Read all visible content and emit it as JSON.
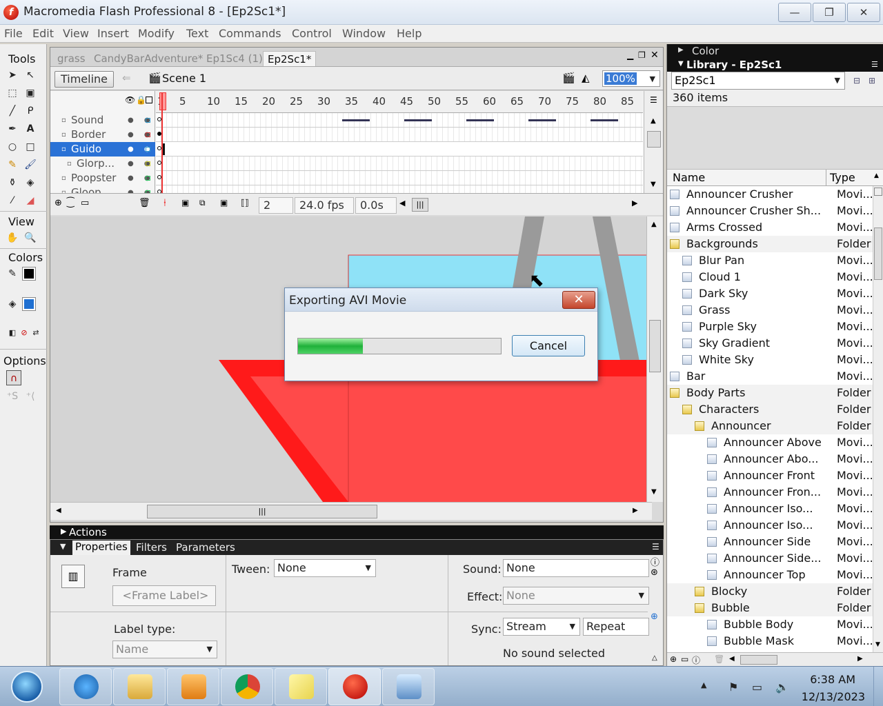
{
  "window": {
    "title": "Macromedia Flash Professional 8 - [Ep2Sc1*]",
    "app_icon_glyph": "f",
    "minimize_glyph": "—",
    "restore_glyph": "❐",
    "close_glyph": "✕"
  },
  "menu": [
    "File",
    "Edit",
    "View",
    "Insert",
    "Modify",
    "Text",
    "Commands",
    "Control",
    "Window",
    "Help"
  ],
  "tools": {
    "tools_label": "Tools",
    "view_label": "View",
    "colors_label": "Colors",
    "options_label": "Options"
  },
  "document": {
    "tabs": [
      "grass",
      "CandyBarAdventure*",
      "Ep1Sc4 (1)",
      "Ep2Sc1*"
    ],
    "active_tab": 3,
    "timeline_button": "Timeline",
    "scene_label": "Scene 1",
    "zoom": "100%"
  },
  "timeline": {
    "layers": [
      {
        "name": "Sound",
        "selected": false
      },
      {
        "name": "Border",
        "selected": false
      },
      {
        "name": "Guido",
        "selected": true
      },
      {
        "name": "Glorp...",
        "selected": false
      },
      {
        "name": "Poopster",
        "selected": false
      },
      {
        "name": "Gloop",
        "selected": false
      }
    ],
    "ruler": [
      "1",
      "5",
      "10",
      "15",
      "20",
      "25",
      "30",
      "35",
      "40",
      "45",
      "50",
      "55",
      "60",
      "65",
      "70",
      "75",
      "80",
      "85"
    ],
    "current_frame": "2",
    "fps": "24.0 fps",
    "elapsed": "0.0s"
  },
  "properties": {
    "actions_label": "Actions",
    "tabs": [
      "Properties",
      "Filters",
      "Parameters"
    ],
    "frame_label": "Frame",
    "frame_label_placeholder": "<Frame Label>",
    "label_type_label": "Label type:",
    "label_type_value": "Name",
    "tween_label": "Tween:",
    "tween_value": "None",
    "sound_label": "Sound:",
    "sound_value": "None",
    "effect_label": "Effect:",
    "effect_value": "None",
    "sync_label": "Sync:",
    "sync_value": "Stream",
    "repeat_value": "Repeat",
    "no_sound": "No sound selected"
  },
  "library": {
    "color_panel_label": "Color",
    "library_label": "Library - Ep2Sc1",
    "document_select": "Ep2Sc1",
    "item_count": "360 items",
    "col_name": "Name",
    "col_type": "Type",
    "items": [
      {
        "name": "Announcer Crusher",
        "type": "Movi...",
        "level": 0,
        "folder": false
      },
      {
        "name": "Announcer Crusher Sh...",
        "type": "Movi...",
        "level": 0,
        "folder": false
      },
      {
        "name": "Arms Crossed",
        "type": "Movi...",
        "level": 0,
        "folder": false
      },
      {
        "name": "Backgrounds",
        "type": "Folder",
        "level": 0,
        "folder": true
      },
      {
        "name": "Blur Pan",
        "type": "Movi...",
        "level": 1,
        "folder": false
      },
      {
        "name": "Cloud 1",
        "type": "Movi...",
        "level": 1,
        "folder": false
      },
      {
        "name": "Dark Sky",
        "type": "Movi...",
        "level": 1,
        "folder": false
      },
      {
        "name": "Grass",
        "type": "Movi...",
        "level": 1,
        "folder": false
      },
      {
        "name": "Purple Sky",
        "type": "Movi...",
        "level": 1,
        "folder": false
      },
      {
        "name": "Sky Gradient",
        "type": "Movi...",
        "level": 1,
        "folder": false
      },
      {
        "name": "White Sky",
        "type": "Movi...",
        "level": 1,
        "folder": false
      },
      {
        "name": "Bar",
        "type": "Movi...",
        "level": 0,
        "folder": false
      },
      {
        "name": "Body Parts",
        "type": "Folder",
        "level": 0,
        "folder": true
      },
      {
        "name": "Characters",
        "type": "Folder",
        "level": 1,
        "folder": true
      },
      {
        "name": "Announcer",
        "type": "Folder",
        "level": 2,
        "folder": true
      },
      {
        "name": "Announcer Above",
        "type": "Movi...",
        "level": 3,
        "folder": false
      },
      {
        "name": "Announcer Abo...",
        "type": "Movi...",
        "level": 3,
        "folder": false
      },
      {
        "name": "Announcer Front",
        "type": "Movi...",
        "level": 3,
        "folder": false
      },
      {
        "name": "Announcer Fron...",
        "type": "Movi...",
        "level": 3,
        "folder": false
      },
      {
        "name": "Announcer Iso...",
        "type": "Movi...",
        "level": 3,
        "folder": false
      },
      {
        "name": "Announcer Iso...",
        "type": "Movi...",
        "level": 3,
        "folder": false
      },
      {
        "name": "Announcer Side",
        "type": "Movi...",
        "level": 3,
        "folder": false
      },
      {
        "name": "Announcer Side...",
        "type": "Movi...",
        "level": 3,
        "folder": false
      },
      {
        "name": "Announcer Top",
        "type": "Movi...",
        "level": 3,
        "folder": false
      },
      {
        "name": "Blocky",
        "type": "Folder",
        "level": 2,
        "folder": true
      },
      {
        "name": "Bubble",
        "type": "Folder",
        "level": 2,
        "folder": true
      },
      {
        "name": "Bubble Body",
        "type": "Movi...",
        "level": 3,
        "folder": false
      },
      {
        "name": "Bubble Mask",
        "type": "Movi...",
        "level": 3,
        "folder": false
      }
    ]
  },
  "dialog": {
    "title": "Exporting AVI Movie",
    "close_glyph": "✕",
    "progress_fraction": 0.32,
    "cancel_label": "Cancel"
  },
  "taskbar": {
    "time": "6:38 AM",
    "date": "12/13/2023"
  },
  "colors": {
    "selection": "#2a72d6",
    "stage_sky": "#8fe2f7",
    "stage_red": "#ff1a1a",
    "progress_green": "#1fb13a"
  }
}
